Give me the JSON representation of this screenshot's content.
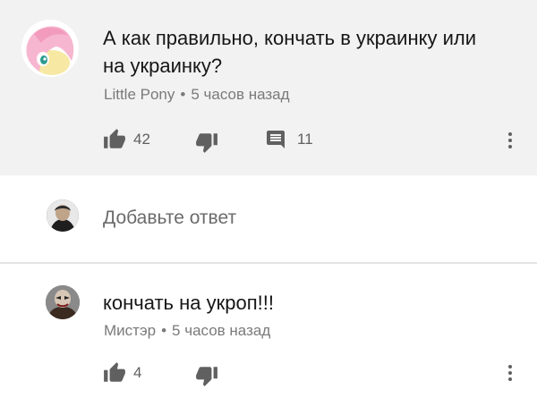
{
  "comment1": {
    "text_line1": "А как правильно, кончать в украинку или",
    "text_line2": "на украинку?",
    "author": "Little Pony",
    "separator": "•",
    "time": "5 часов назад",
    "likes": "42",
    "replies": "11"
  },
  "reply_box": {
    "placeholder": "Добавьте ответ"
  },
  "comment2": {
    "text": "кончать на укроп!!!",
    "author": "Мистэр",
    "separator": "•",
    "time": "5 часов назад",
    "likes": "4"
  },
  "icons": {
    "like": "thumbs-up-icon",
    "dislike": "thumbs-down-icon",
    "reply": "comment-icon",
    "more": "more-vert-icon"
  },
  "colors": {
    "highlight_bg": "#f2f2f2",
    "icon": "#606060",
    "text": "#161616",
    "meta": "#7a7a7a"
  }
}
